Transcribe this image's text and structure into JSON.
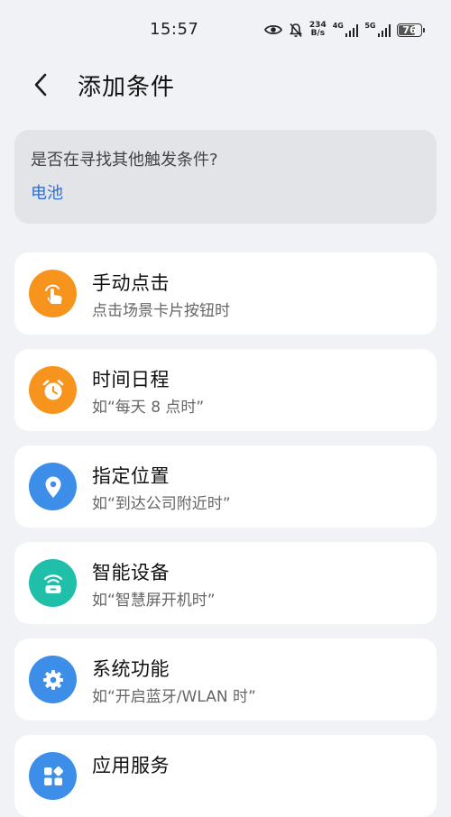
{
  "status_bar": {
    "time": "15:57",
    "net_speed_value": "234",
    "net_speed_unit": "B/s",
    "sim1_label": "4G",
    "sim2_label": "5G",
    "battery_level": "76",
    "battery_fraction": 0.76,
    "icons": [
      "eye-icon",
      "mute-bell-icon",
      "signal-4g-icon",
      "signal-5g-icon",
      "battery-icon"
    ]
  },
  "header": {
    "back_icon": "chevron-left-icon",
    "title": "添加条件"
  },
  "suggestion": {
    "question": "是否在寻找其他触发条件?",
    "link_label": "电池"
  },
  "conditions": [
    {
      "title": "手动点击",
      "subtitle": "点击场景卡片按钮时",
      "icon": "tap-hand-icon",
      "color": "#f7941d"
    },
    {
      "title": "时间日程",
      "subtitle": "如“每天 8 点时”",
      "icon": "alarm-clock-icon",
      "color": "#f7941d"
    },
    {
      "title": "指定位置",
      "subtitle": "如“到达公司附近时”",
      "icon": "location-pin-icon",
      "color": "#3d8ee8"
    },
    {
      "title": "智能设备",
      "subtitle": "如“智慧屏开机时”",
      "icon": "smart-device-icon",
      "color": "#1fbfaa"
    },
    {
      "title": "系统功能",
      "subtitle": "如“开启蓝牙/WLAN 时”",
      "icon": "gear-icon",
      "color": "#3d8ee8"
    },
    {
      "title": "应用服务",
      "subtitle": "",
      "icon": "app-grid-icon",
      "color": "#3d8ee8"
    }
  ]
}
